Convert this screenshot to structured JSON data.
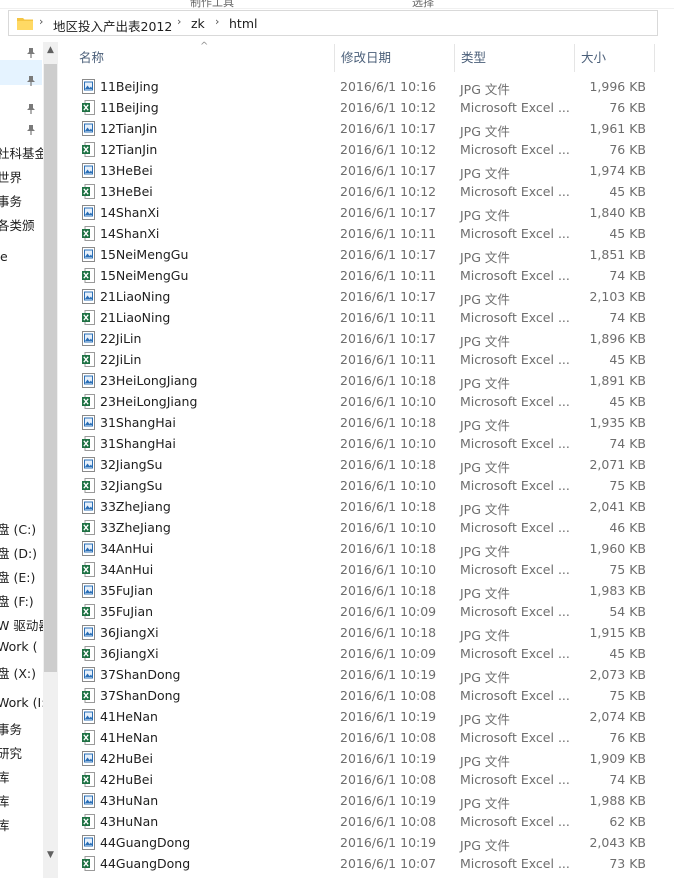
{
  "ribbon": {
    "fragments": [
      "制作工具",
      "选择"
    ]
  },
  "address": {
    "breadcrumbs": [
      "地区投入产出表2012",
      "zk",
      "html"
    ]
  },
  "nav": {
    "items": [
      {
        "label": "",
        "pinned": true
      },
      {
        "label": "",
        "pinned": true
      },
      {
        "label": "",
        "pinned": true
      },
      {
        "label": "",
        "pinned": true
      },
      {
        "label": "社科基金",
        "pinned": false
      },
      {
        "label": "世界",
        "pinned": false
      },
      {
        "label": "事务",
        "pinned": false
      },
      {
        "label": "各类颁",
        "pinned": false
      },
      {
        "label": "e",
        "pinned": false
      },
      {
        "label": "盘 (C:)",
        "pinned": false
      },
      {
        "label": "盘 (D:)",
        "pinned": false
      },
      {
        "label": "盘 (E:)",
        "pinned": false
      },
      {
        "label": "盘 (F:)",
        "pinned": false
      },
      {
        "label": "W 驱动器",
        "pinned": false
      },
      {
        "label": "Work (",
        "pinned": false
      },
      {
        "label": "盘 (X:)",
        "pinned": false
      },
      {
        "label": "Work (I:)",
        "pinned": false
      },
      {
        "label": "事务",
        "pinned": false
      },
      {
        "label": "研究",
        "pinned": false
      },
      {
        "label": "库",
        "pinned": false
      },
      {
        "label": "库",
        "pinned": false
      },
      {
        "label": "库",
        "pinned": false
      }
    ]
  },
  "columns": {
    "name": "名称",
    "date": "修改日期",
    "type": "类型",
    "size": "大小"
  },
  "files": [
    {
      "name": "11BeiJing",
      "date": "2016/6/1 10:16",
      "type": "JPG 文件",
      "size": "1,996 KB",
      "icon": "jpg"
    },
    {
      "name": "11BeiJing",
      "date": "2016/6/1 10:12",
      "type": "Microsoft Excel ...",
      "size": "76 KB",
      "icon": "excel"
    },
    {
      "name": "12TianJin",
      "date": "2016/6/1 10:17",
      "type": "JPG 文件",
      "size": "1,961 KB",
      "icon": "jpg"
    },
    {
      "name": "12TianJin",
      "date": "2016/6/1 10:12",
      "type": "Microsoft Excel ...",
      "size": "76 KB",
      "icon": "excel"
    },
    {
      "name": "13HeBei",
      "date": "2016/6/1 10:17",
      "type": "JPG 文件",
      "size": "1,974 KB",
      "icon": "jpg"
    },
    {
      "name": "13HeBei",
      "date": "2016/6/1 10:12",
      "type": "Microsoft Excel ...",
      "size": "45 KB",
      "icon": "excel"
    },
    {
      "name": "14ShanXi",
      "date": "2016/6/1 10:17",
      "type": "JPG 文件",
      "size": "1,840 KB",
      "icon": "jpg"
    },
    {
      "name": "14ShanXi",
      "date": "2016/6/1 10:11",
      "type": "Microsoft Excel ...",
      "size": "45 KB",
      "icon": "excel"
    },
    {
      "name": "15NeiMengGu",
      "date": "2016/6/1 10:17",
      "type": "JPG 文件",
      "size": "1,851 KB",
      "icon": "jpg"
    },
    {
      "name": "15NeiMengGu",
      "date": "2016/6/1 10:11",
      "type": "Microsoft Excel ...",
      "size": "74 KB",
      "icon": "excel"
    },
    {
      "name": "21LiaoNing",
      "date": "2016/6/1 10:17",
      "type": "JPG 文件",
      "size": "2,103 KB",
      "icon": "jpg"
    },
    {
      "name": "21LiaoNing",
      "date": "2016/6/1 10:11",
      "type": "Microsoft Excel ...",
      "size": "74 KB",
      "icon": "excel"
    },
    {
      "name": "22JiLin",
      "date": "2016/6/1 10:17",
      "type": "JPG 文件",
      "size": "1,896 KB",
      "icon": "jpg"
    },
    {
      "name": "22JiLin",
      "date": "2016/6/1 10:11",
      "type": "Microsoft Excel ...",
      "size": "45 KB",
      "icon": "excel"
    },
    {
      "name": "23HeiLongJiang",
      "date": "2016/6/1 10:18",
      "type": "JPG 文件",
      "size": "1,891 KB",
      "icon": "jpg"
    },
    {
      "name": "23HeiLongJiang",
      "date": "2016/6/1 10:10",
      "type": "Microsoft Excel ...",
      "size": "45 KB",
      "icon": "excel"
    },
    {
      "name": "31ShangHai",
      "date": "2016/6/1 10:18",
      "type": "JPG 文件",
      "size": "1,935 KB",
      "icon": "jpg"
    },
    {
      "name": "31ShangHai",
      "date": "2016/6/1 10:10",
      "type": "Microsoft Excel ...",
      "size": "74 KB",
      "icon": "excel"
    },
    {
      "name": "32JiangSu",
      "date": "2016/6/1 10:18",
      "type": "JPG 文件",
      "size": "2,071 KB",
      "icon": "jpg"
    },
    {
      "name": "32JiangSu",
      "date": "2016/6/1 10:10",
      "type": "Microsoft Excel ...",
      "size": "75 KB",
      "icon": "excel"
    },
    {
      "name": "33ZheJiang",
      "date": "2016/6/1 10:18",
      "type": "JPG 文件",
      "size": "2,041 KB",
      "icon": "jpg"
    },
    {
      "name": "33ZheJiang",
      "date": "2016/6/1 10:10",
      "type": "Microsoft Excel ...",
      "size": "46 KB",
      "icon": "excel"
    },
    {
      "name": "34AnHui",
      "date": "2016/6/1 10:18",
      "type": "JPG 文件",
      "size": "1,960 KB",
      "icon": "jpg"
    },
    {
      "name": "34AnHui",
      "date": "2016/6/1 10:10",
      "type": "Microsoft Excel ...",
      "size": "75 KB",
      "icon": "excel"
    },
    {
      "name": "35FuJian",
      "date": "2016/6/1 10:18",
      "type": "JPG 文件",
      "size": "1,983 KB",
      "icon": "jpg"
    },
    {
      "name": "35FuJian",
      "date": "2016/6/1 10:09",
      "type": "Microsoft Excel ...",
      "size": "54 KB",
      "icon": "excel"
    },
    {
      "name": "36JiangXi",
      "date": "2016/6/1 10:18",
      "type": "JPG 文件",
      "size": "1,915 KB",
      "icon": "jpg"
    },
    {
      "name": "36JiangXi",
      "date": "2016/6/1 10:09",
      "type": "Microsoft Excel ...",
      "size": "45 KB",
      "icon": "excel"
    },
    {
      "name": "37ShanDong",
      "date": "2016/6/1 10:19",
      "type": "JPG 文件",
      "size": "2,073 KB",
      "icon": "jpg"
    },
    {
      "name": "37ShanDong",
      "date": "2016/6/1 10:08",
      "type": "Microsoft Excel ...",
      "size": "75 KB",
      "icon": "excel"
    },
    {
      "name": "41HeNan",
      "date": "2016/6/1 10:19",
      "type": "JPG 文件",
      "size": "2,074 KB",
      "icon": "jpg"
    },
    {
      "name": "41HeNan",
      "date": "2016/6/1 10:08",
      "type": "Microsoft Excel ...",
      "size": "76 KB",
      "icon": "excel"
    },
    {
      "name": "42HuBei",
      "date": "2016/6/1 10:19",
      "type": "JPG 文件",
      "size": "1,909 KB",
      "icon": "jpg"
    },
    {
      "name": "42HuBei",
      "date": "2016/6/1 10:08",
      "type": "Microsoft Excel ...",
      "size": "74 KB",
      "icon": "excel"
    },
    {
      "name": "43HuNan",
      "date": "2016/6/1 10:19",
      "type": "JPG 文件",
      "size": "1,988 KB",
      "icon": "jpg"
    },
    {
      "name": "43HuNan",
      "date": "2016/6/1 10:08",
      "type": "Microsoft Excel ...",
      "size": "62 KB",
      "icon": "excel"
    },
    {
      "name": "44GuangDong",
      "date": "2016/6/1 10:19",
      "type": "JPG 文件",
      "size": "2,043 KB",
      "icon": "jpg"
    },
    {
      "name": "44GuangDong",
      "date": "2016/6/1 10:07",
      "type": "Microsoft Excel ...",
      "size": "73 KB",
      "icon": "excel"
    }
  ],
  "colors": {
    "excel_green": "#1f7244",
    "jpg_blue": "#2b6fb6",
    "folder_yellow": "#f5c542",
    "header_text": "#4c607a",
    "selection": "#e5f3ff"
  }
}
